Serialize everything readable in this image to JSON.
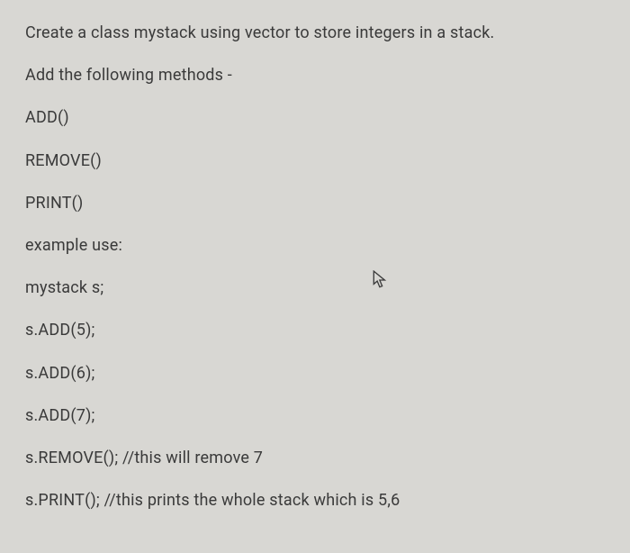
{
  "lines": [
    "Create a class mystack using vector to store integers in a stack.",
    "Add the following methods -",
    "ADD()",
    "REMOVE()",
    "PRINT()",
    "example use:",
    "mystack s;",
    "s.ADD(5);",
    "s.ADD(6);",
    "s.ADD(7);",
    "s.REMOVE(); //this will remove 7",
    "s.PRINT(); //this prints the whole stack which is 5,6"
  ]
}
